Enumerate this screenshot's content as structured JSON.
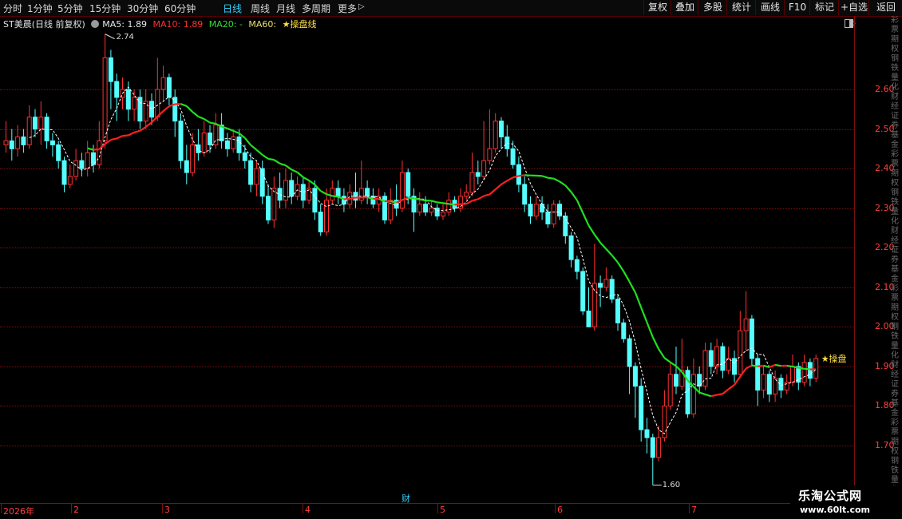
{
  "periods": [
    "分时",
    "1分钟",
    "5分钟",
    "15分钟",
    "30分钟",
    "60分钟",
    "日线",
    "周线",
    "月线",
    "多周期",
    "更多"
  ],
  "active_period": "日线",
  "more_arrow": "▷",
  "toolbar_buttons": [
    "复权",
    "叠加",
    "多股",
    "统计",
    "画线",
    "F10",
    "标记",
    "+自选",
    "返回"
  ],
  "info": {
    "stock": "ST美晨(日线 前复权)",
    "ma5": "MA5: 1.89",
    "ma10": "MA10: 1.89",
    "ma20": "MA20: -",
    "ma60": "MA60:",
    "custom": "★操盘线"
  },
  "colors": {
    "up": "#ff3030",
    "down": "#54ffff",
    "ma_red": "#ff2020",
    "ma_green": "#20e020",
    "label": "#ff4040"
  },
  "y_labels": [
    "2.60",
    "2.50",
    "2.40",
    "2.30",
    "2.20",
    "2.10",
    "2.00",
    "1.90",
    "1.80",
    "1.70"
  ],
  "high_label": "2.74",
  "low_label": "1.60",
  "right_tag": "★操盘",
  "dates": [
    "2026年",
    "2",
    "3",
    "4",
    "5",
    "6",
    "7"
  ],
  "cai": "财",
  "watermark": {
    "title": "乐淘公式网",
    "url": "www.60lt.com"
  },
  "edge_text": "彩票期权钢铁量化财经证券基金彩票期权钢铁量化财经证券基金彩票期权钢铁量化财经证券基金彩票期权钢铁量化财经证券基金彩票期权钢铁量化财经证券基金",
  "chart_data": {
    "type": "candlestick",
    "ylim": [
      1.6,
      2.74
    ],
    "candles": [
      [
        2.46,
        2.47,
        2.52,
        2.44
      ],
      [
        2.47,
        2.45,
        2.5,
        2.42
      ],
      [
        2.45,
        2.48,
        2.51,
        2.43
      ],
      [
        2.48,
        2.46,
        2.5,
        2.44
      ],
      [
        2.46,
        2.53,
        2.56,
        2.45
      ],
      [
        2.53,
        2.5,
        2.55,
        2.48
      ],
      [
        2.5,
        2.53,
        2.57,
        2.46
      ],
      [
        2.53,
        2.47,
        2.54,
        2.45
      ],
      [
        2.47,
        2.46,
        2.49,
        2.43
      ],
      [
        2.46,
        2.42,
        2.47,
        2.4
      ],
      [
        2.42,
        2.36,
        2.43,
        2.34
      ],
      [
        2.36,
        2.38,
        2.41,
        2.35
      ],
      [
        2.38,
        2.42,
        2.45,
        2.37
      ],
      [
        2.42,
        2.4,
        2.44,
        2.38
      ],
      [
        2.4,
        2.44,
        2.47,
        2.38
      ],
      [
        2.44,
        2.41,
        2.46,
        2.39
      ],
      [
        2.41,
        2.47,
        2.52,
        2.4
      ],
      [
        2.47,
        2.68,
        2.74,
        2.45
      ],
      [
        2.68,
        2.62,
        2.7,
        2.55
      ],
      [
        2.62,
        2.58,
        2.64,
        2.52
      ],
      [
        2.58,
        2.6,
        2.63,
        2.55
      ],
      [
        2.6,
        2.55,
        2.62,
        2.52
      ],
      [
        2.55,
        2.58,
        2.6,
        2.52
      ],
      [
        2.58,
        2.52,
        2.6,
        2.5
      ],
      [
        2.52,
        2.57,
        2.6,
        2.5
      ],
      [
        2.57,
        2.53,
        2.59,
        2.51
      ],
      [
        2.53,
        2.6,
        2.68,
        2.52
      ],
      [
        2.6,
        2.63,
        2.66,
        2.57
      ],
      [
        2.63,
        2.58,
        2.64,
        2.56
      ],
      [
        2.58,
        2.52,
        2.6,
        2.48
      ],
      [
        2.52,
        2.42,
        2.54,
        2.4
      ],
      [
        2.42,
        2.39,
        2.46,
        2.36
      ],
      [
        2.39,
        2.46,
        2.49,
        2.38
      ],
      [
        2.46,
        2.44,
        2.5,
        2.42
      ],
      [
        2.44,
        2.49,
        2.52,
        2.43
      ],
      [
        2.49,
        2.46,
        2.51,
        2.44
      ],
      [
        2.46,
        2.51,
        2.54,
        2.45
      ],
      [
        2.51,
        2.47,
        2.54,
        2.45
      ],
      [
        2.47,
        2.45,
        2.49,
        2.43
      ],
      [
        2.45,
        2.48,
        2.5,
        2.44
      ],
      [
        2.48,
        2.44,
        2.5,
        2.42
      ],
      [
        2.44,
        2.42,
        2.46,
        2.4
      ],
      [
        2.42,
        2.36,
        2.44,
        2.34
      ],
      [
        2.36,
        2.4,
        2.42,
        2.33
      ],
      [
        2.4,
        2.33,
        2.42,
        2.31
      ],
      [
        2.33,
        2.27,
        2.36,
        2.26
      ],
      [
        2.27,
        2.35,
        2.38,
        2.25
      ],
      [
        2.35,
        2.32,
        2.39,
        2.3
      ],
      [
        2.32,
        2.37,
        2.4,
        2.3
      ],
      [
        2.37,
        2.33,
        2.39,
        2.31
      ],
      [
        2.33,
        2.36,
        2.38,
        2.32
      ],
      [
        2.36,
        2.32,
        2.38,
        2.3
      ],
      [
        2.32,
        2.35,
        2.37,
        2.31
      ],
      [
        2.35,
        2.29,
        2.37,
        2.27
      ],
      [
        2.29,
        2.24,
        2.31,
        2.23
      ],
      [
        2.24,
        2.32,
        2.35,
        2.23
      ],
      [
        2.32,
        2.35,
        2.37,
        2.31
      ],
      [
        2.35,
        2.33,
        2.37,
        2.31
      ],
      [
        2.33,
        2.31,
        2.35,
        2.29
      ],
      [
        2.31,
        2.34,
        2.36,
        2.3
      ],
      [
        2.34,
        2.32,
        2.39,
        2.3
      ],
      [
        2.32,
        2.35,
        2.42,
        2.31
      ],
      [
        2.35,
        2.33,
        2.37,
        2.31
      ],
      [
        2.33,
        2.31,
        2.35,
        2.3
      ],
      [
        2.31,
        2.33,
        2.35,
        2.29
      ],
      [
        2.33,
        2.27,
        2.34,
        2.26
      ],
      [
        2.27,
        2.32,
        2.35,
        2.26
      ],
      [
        2.32,
        2.3,
        2.36,
        2.28
      ],
      [
        2.3,
        2.39,
        2.42,
        2.29
      ],
      [
        2.39,
        2.33,
        2.4,
        2.31
      ],
      [
        2.33,
        2.29,
        2.35,
        2.24
      ],
      [
        2.29,
        2.31,
        2.34,
        2.28
      ],
      [
        2.31,
        2.29,
        2.33,
        2.28
      ],
      [
        2.29,
        2.3,
        2.32,
        2.28
      ],
      [
        2.3,
        2.28,
        2.31,
        2.27
      ],
      [
        2.28,
        2.29,
        2.31,
        2.27
      ],
      [
        2.29,
        2.32,
        2.34,
        2.28
      ],
      [
        2.32,
        2.3,
        2.33,
        2.29
      ],
      [
        2.3,
        2.33,
        2.35,
        2.29
      ],
      [
        2.33,
        2.34,
        2.36,
        2.32
      ],
      [
        2.34,
        2.39,
        2.44,
        2.33
      ],
      [
        2.39,
        2.38,
        2.42,
        2.36
      ],
      [
        2.38,
        2.42,
        2.52,
        2.37
      ],
      [
        2.42,
        2.45,
        2.55,
        2.41
      ],
      [
        2.45,
        2.52,
        2.54,
        2.44
      ],
      [
        2.52,
        2.48,
        2.53,
        2.45
      ],
      [
        2.48,
        2.45,
        2.51,
        2.43
      ],
      [
        2.45,
        2.41,
        2.47,
        2.4
      ],
      [
        2.41,
        2.36,
        2.43,
        2.34
      ],
      [
        2.36,
        2.31,
        2.38,
        2.29
      ],
      [
        2.31,
        2.28,
        2.33,
        2.26
      ],
      [
        2.28,
        2.31,
        2.33,
        2.27
      ],
      [
        2.31,
        2.29,
        2.33,
        2.27
      ],
      [
        2.29,
        2.26,
        2.31,
        2.25
      ],
      [
        2.26,
        2.31,
        2.32,
        2.25
      ],
      [
        2.31,
        2.28,
        2.32,
        2.27
      ],
      [
        2.28,
        2.23,
        2.29,
        2.21
      ],
      [
        2.23,
        2.17,
        2.24,
        2.15
      ],
      [
        2.17,
        2.14,
        2.18,
        2.12
      ],
      [
        2.14,
        2.04,
        2.15,
        2.03
      ],
      [
        2.04,
        2.0,
        2.1,
        2.0
      ],
      [
        2.0,
        2.11,
        2.21,
        1.99
      ],
      [
        2.11,
        2.1,
        2.13,
        2.05
      ],
      [
        2.1,
        2.12,
        2.15,
        2.09
      ],
      [
        2.12,
        2.07,
        2.13,
        2.06
      ],
      [
        2.07,
        2.01,
        2.08,
        1.99
      ],
      [
        2.01,
        1.97,
        2.02,
        1.96
      ],
      [
        1.97,
        1.9,
        1.98,
        1.83
      ],
      [
        1.9,
        1.85,
        1.91,
        1.77
      ],
      [
        1.85,
        1.74,
        1.87,
        1.71
      ],
      [
        1.74,
        1.72,
        1.77,
        1.68
      ],
      [
        1.72,
        1.67,
        1.73,
        1.6
      ],
      [
        1.67,
        1.72,
        1.75,
        1.66
      ],
      [
        1.72,
        1.8,
        1.84,
        1.71
      ],
      [
        1.8,
        1.88,
        1.91,
        1.79
      ],
      [
        1.88,
        1.85,
        1.95,
        1.83
      ],
      [
        1.85,
        1.89,
        1.97,
        1.84
      ],
      [
        1.89,
        1.78,
        1.9,
        1.77
      ],
      [
        1.78,
        1.88,
        1.92,
        1.77
      ],
      [
        1.88,
        1.85,
        1.9,
        1.83
      ],
      [
        1.85,
        1.94,
        1.96,
        1.84
      ],
      [
        1.94,
        1.9,
        1.96,
        1.88
      ],
      [
        1.9,
        1.95,
        1.97,
        1.88
      ],
      [
        1.95,
        1.89,
        1.96,
        1.87
      ],
      [
        1.89,
        1.92,
        1.95,
        1.88
      ],
      [
        1.92,
        1.88,
        1.94,
        1.86
      ],
      [
        1.88,
        1.99,
        2.04,
        1.87
      ],
      [
        1.99,
        2.02,
        2.09,
        1.94
      ],
      [
        2.02,
        1.92,
        2.03,
        1.9
      ],
      [
        1.92,
        1.84,
        1.93,
        1.8
      ],
      [
        1.84,
        1.88,
        1.9,
        1.82
      ],
      [
        1.88,
        1.83,
        1.89,
        1.81
      ],
      [
        1.83,
        1.87,
        1.89,
        1.81
      ],
      [
        1.87,
        1.84,
        1.88,
        1.82
      ],
      [
        1.84,
        1.86,
        1.88,
        1.83
      ],
      [
        1.86,
        1.9,
        1.93,
        1.85
      ],
      [
        1.9,
        1.86,
        1.91,
        1.84
      ],
      [
        1.86,
        1.91,
        1.93,
        1.85
      ],
      [
        1.91,
        1.87,
        1.92,
        1.85
      ],
      [
        1.87,
        1.92,
        1.93,
        1.86
      ]
    ]
  }
}
